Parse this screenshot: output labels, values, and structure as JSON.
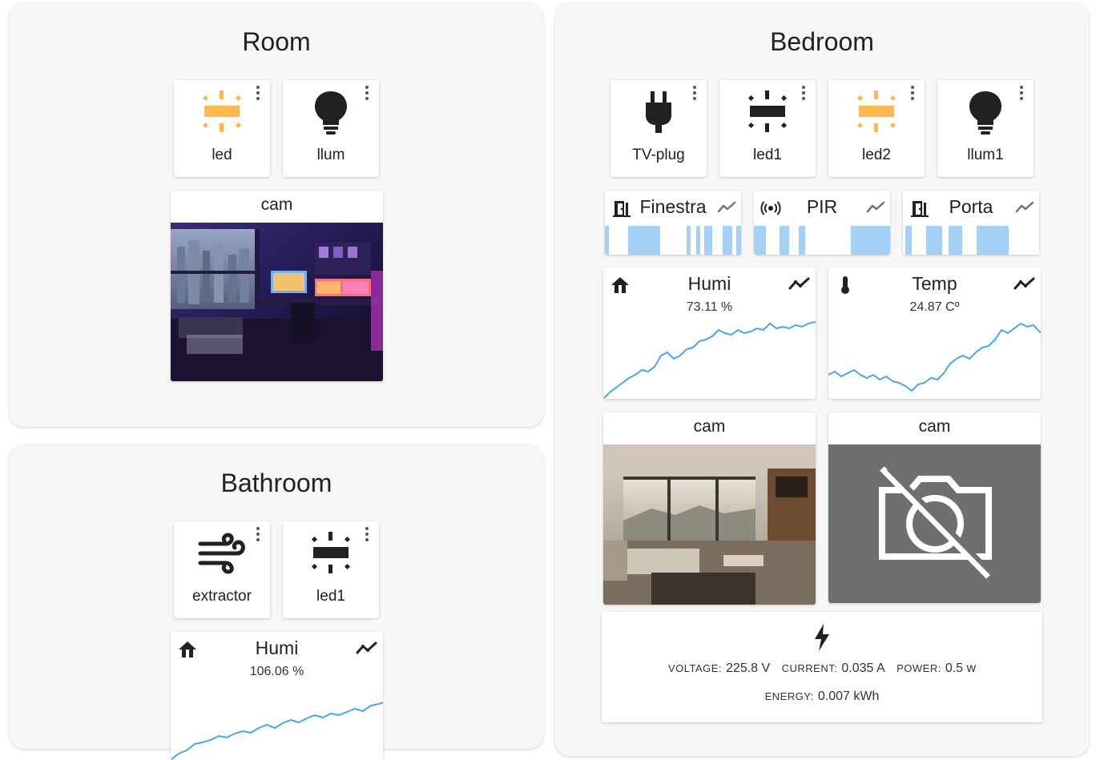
{
  "room": {
    "title": "Room",
    "buttons": [
      {
        "label": "led",
        "icon": "led-strip-on-icon",
        "color": "#FFB74D"
      },
      {
        "label": "llum",
        "icon": "lightbulb-icon",
        "color": "#212121"
      }
    ],
    "cam": {
      "title": "cam"
    }
  },
  "bathroom": {
    "title": "Bathroom",
    "buttons": [
      {
        "label": "extractor",
        "icon": "fan-wind-icon"
      },
      {
        "label": "led1",
        "icon": "led-strip-icon"
      }
    ],
    "humi": {
      "name": "Humi",
      "value": "106.06 %",
      "icon": "home-icon"
    }
  },
  "bedroom": {
    "title": "Bedroom",
    "buttons": [
      {
        "label": "TV-plug",
        "icon": "power-plug-icon"
      },
      {
        "label": "led1",
        "icon": "led-strip-icon"
      },
      {
        "label": "led2",
        "icon": "led-strip-on-icon",
        "color": "#FFB74D"
      },
      {
        "label": "llum1",
        "icon": "lightbulb-icon"
      }
    ],
    "binary_sensors": [
      {
        "name": "Finestra",
        "icon": "door-open-icon"
      },
      {
        "name": "PIR",
        "icon": "motion-sensor-icon"
      },
      {
        "name": "Porta",
        "icon": "door-open-icon"
      }
    ],
    "sensors": [
      {
        "name": "Humi",
        "value": "73.11 %",
        "icon": "home-icon"
      },
      {
        "name": "Temp",
        "value": "24.87 Cº",
        "icon": "thermometer-icon"
      }
    ],
    "cams": [
      {
        "title": "cam"
      },
      {
        "title": "cam"
      }
    ],
    "energy": {
      "voltage_label": "VOLTAGE:",
      "voltage": "225.8 V",
      "current_label": "CURRENT:",
      "current": "0.035 A",
      "power_label": "POWER:",
      "power": "0.5 w",
      "energy_label": "ENERGY:",
      "energy": "0.007 kWh"
    }
  },
  "colors": {
    "accent": "#42A5F5",
    "bar_on": "#A4CFF7",
    "led_on": "#FFB74D",
    "panel_bg": "#F7F7F7"
  }
}
